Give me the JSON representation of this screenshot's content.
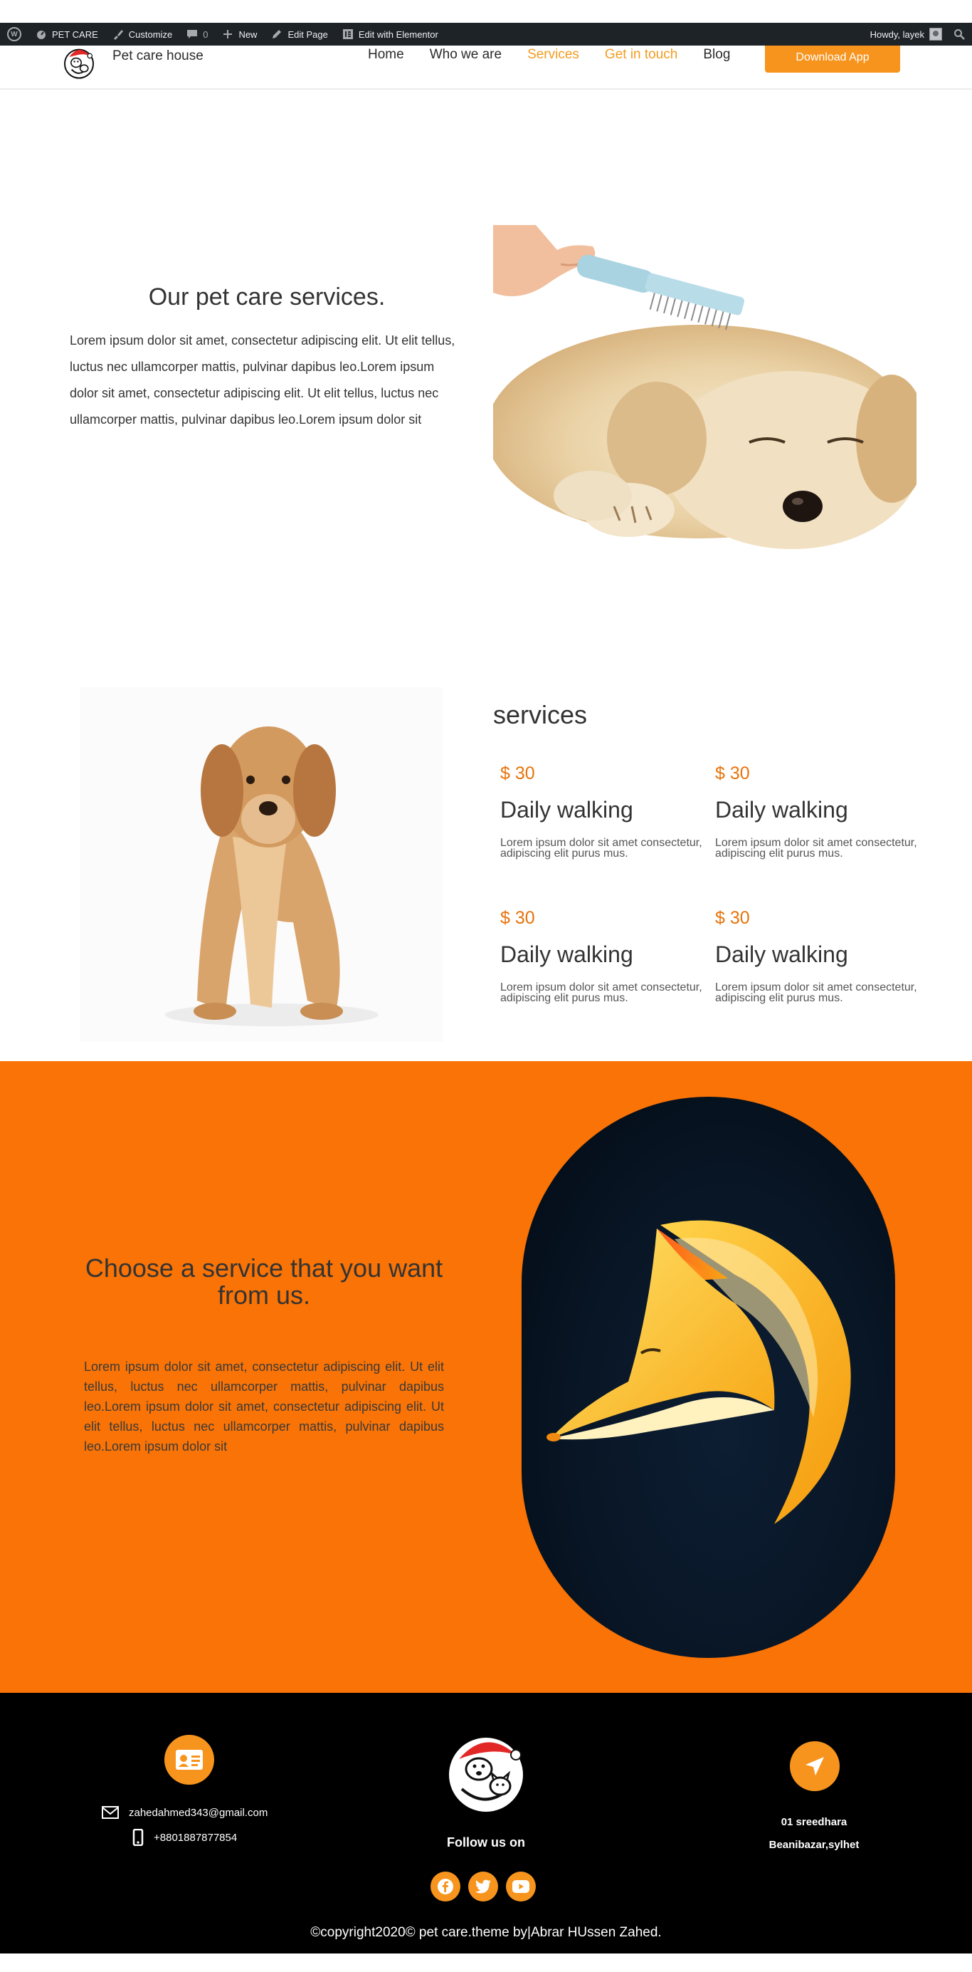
{
  "adminbar": {
    "site": "PET CARE",
    "customize": "Customize",
    "comments_count": "0",
    "new": "New",
    "edit_page": "Edit Page",
    "edit_elementor": "Edit with Elementor",
    "howdy": "Howdy, layek"
  },
  "header": {
    "site_name": "Pet care house",
    "nav": [
      "Home",
      "Who we are",
      "Services",
      "Get in touch",
      "Blog"
    ],
    "download_label": "Download App"
  },
  "hero": {
    "title": "Our pet care services.",
    "text": "Lorem ipsum dolor sit amet, consectetur adipiscing elit. Ut elit tellus, luctus nec ullamcorper mattis, pulvinar dapibus leo.Lorem ipsum dolor sit amet, consectetur adipiscing elit. Ut elit tellus, luctus nec ullamcorper mattis, pulvinar dapibus leo.Lorem ipsum dolor sit"
  },
  "services": {
    "title": "services",
    "items": [
      {
        "price": "$ 30",
        "name": "Daily walking",
        "desc": "Lorem ipsum dolor sit amet consectetur, adipiscing elit purus mus."
      },
      {
        "price": "$ 30",
        "name": "Daily walking",
        "desc": "Lorem ipsum dolor sit amet consectetur, adipiscing elit purus mus."
      },
      {
        "price": "$ 30",
        "name": "Daily walking",
        "desc": "Lorem ipsum dolor sit amet consectetur, adipiscing elit purus mus."
      },
      {
        "price": "$ 30",
        "name": "Daily walking",
        "desc": "Lorem ipsum dolor sit amet consectetur, adipiscing elit purus mus."
      }
    ]
  },
  "choose": {
    "title": "Choose a service that you want from us.",
    "text": "Lorem ipsum dolor sit amet, consectetur adipiscing elit. Ut elit tellus, luctus nec ullamcorper mattis, pulvinar dapibus leo.Lorem ipsum dolor sit amet, consectetur adipiscing elit. Ut elit tellus, luctus nec ullamcorper mattis, pulvinar dapibus leo.Lorem ipsum dolor sit"
  },
  "footer": {
    "email": "zahedahmed343@gmail.com",
    "phone": "+8801887877854",
    "follow": "Follow us on",
    "address_line1": "01 sreedhara",
    "address_line2": "Beanibazar,sylhet",
    "copyright": "©copyright2020© pet care.theme by|Abrar HUssen Zahed."
  },
  "colors": {
    "accent": "#f7941d",
    "orange_section": "#f97306",
    "price": "#e8730c",
    "footer_bg": "#000000",
    "adminbar_bg": "#1d2327"
  },
  "icons": [
    "wordpress-icon",
    "paint-brush-icon",
    "comment-icon",
    "plus-icon",
    "pencil-icon",
    "elementor-icon",
    "search-icon",
    "id-card-icon",
    "envelope-icon",
    "mobile-phone-icon",
    "location-arrow-icon",
    "facebook-icon",
    "twitter-icon",
    "youtube-icon"
  ]
}
